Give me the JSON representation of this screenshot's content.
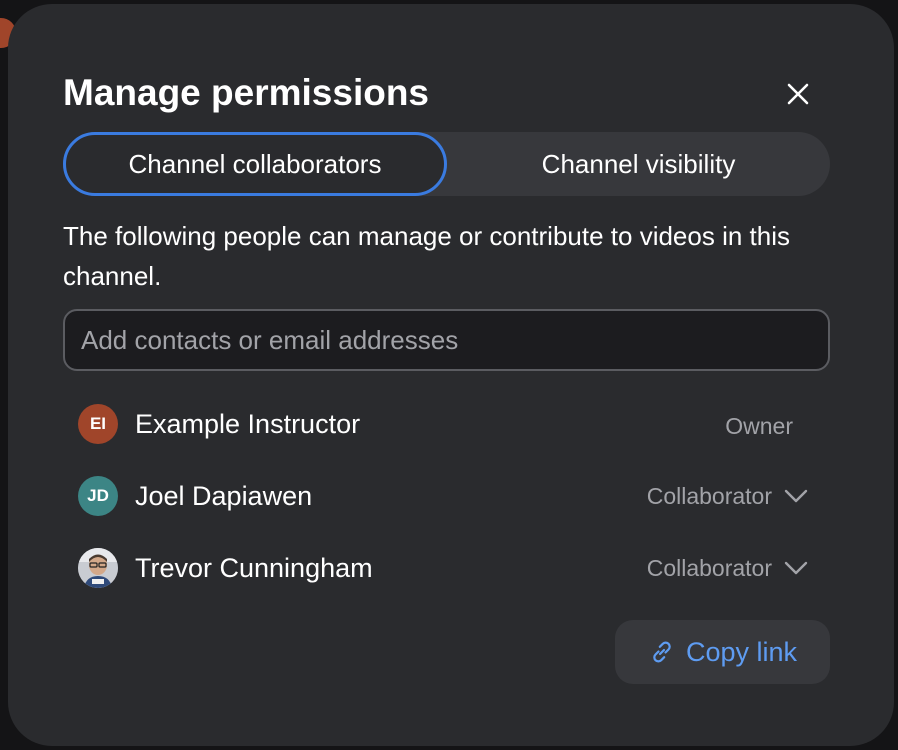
{
  "modal": {
    "title": "Manage permissions",
    "close_icon": "close-icon"
  },
  "tabs": [
    {
      "label": "Channel collaborators",
      "active": true
    },
    {
      "label": "Channel visibility",
      "active": false
    }
  ],
  "description": "The following people can manage or contribute to videos in this channel.",
  "search": {
    "placeholder": "Add contacts or email addresses",
    "value": ""
  },
  "people": [
    {
      "initials": "EI",
      "name": "Example Instructor",
      "role": "Owner",
      "avatar_color": "#a0452a",
      "role_editable": false
    },
    {
      "initials": "JD",
      "name": "Joel Dapiawen",
      "role": "Collaborator",
      "avatar_color": "#3c8585",
      "role_editable": true
    },
    {
      "initials": "",
      "name": "Trevor Cunningham",
      "role": "Collaborator",
      "avatar_color": "#8a8f99",
      "role_editable": true,
      "avatar_type": "photo"
    }
  ],
  "copy_link": {
    "label": "Copy link",
    "icon": "link-icon"
  },
  "colors": {
    "modal_bg": "#2a2b2e",
    "accent": "#3a7be0",
    "link": "#5e9cf2"
  }
}
